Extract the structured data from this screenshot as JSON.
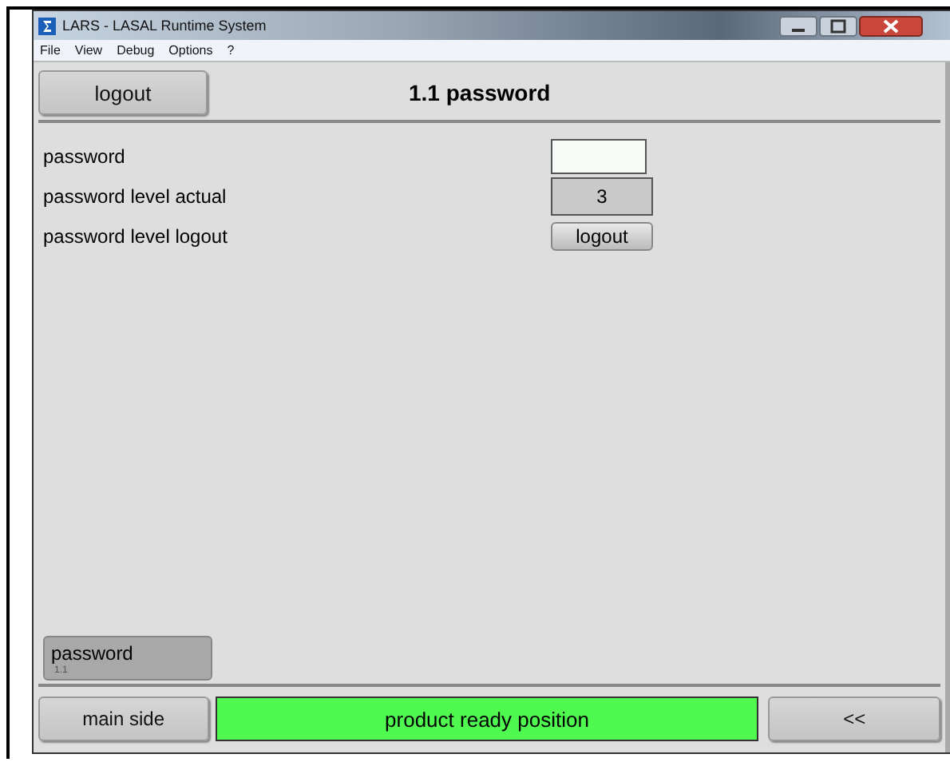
{
  "window": {
    "title": "LARS - LASAL Runtime System"
  },
  "menu": [
    "File",
    "View",
    "Debug",
    "Options",
    "?"
  ],
  "header": {
    "button": "logout",
    "title": "1.1 password"
  },
  "rows": [
    {
      "label": "password",
      "kind": "input"
    },
    {
      "label": "password level actual",
      "kind": "display",
      "value": "3"
    },
    {
      "label": "password level logout",
      "kind": "button",
      "value": "logout"
    }
  ],
  "page_button": {
    "label": "password",
    "index": "1.1"
  },
  "footer": {
    "left": "main side",
    "status": {
      "text": "product ready position",
      "color": "#50f950"
    },
    "right": "<<"
  }
}
